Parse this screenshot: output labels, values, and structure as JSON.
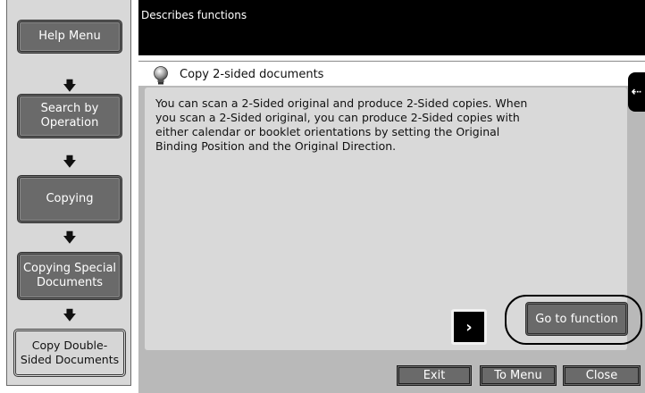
{
  "header": {
    "text": "Describes functions"
  },
  "sidebar": {
    "items": [
      {
        "label": "Help Menu"
      },
      {
        "label": "Search by\nOperation"
      },
      {
        "label": "Copying"
      },
      {
        "label": "Copying Special\nDocuments"
      },
      {
        "label": "Copy Double-\nSided Documents"
      }
    ],
    "arrow": "🡇"
  },
  "panel": {
    "title": "Copy 2-sided documents",
    "description": "You can scan a 2-Sided original and produce 2-Sided copies. When you scan a 2-Sided original, you can produce 2-Sided copies with either calendar or booklet orientations by setting the Original Binding Position and the Original Direction.",
    "next_glyph": "›",
    "goto_label": "Go to function",
    "side_tab_glyph": "⇠"
  },
  "footer": {
    "exit_label": "Exit",
    "menu_label": "To Menu",
    "close_label": "Close"
  },
  "colors": {
    "button_dark": "#6a6a6a",
    "panel_bg": "#b9b9b9",
    "header_bg": "#000000"
  }
}
